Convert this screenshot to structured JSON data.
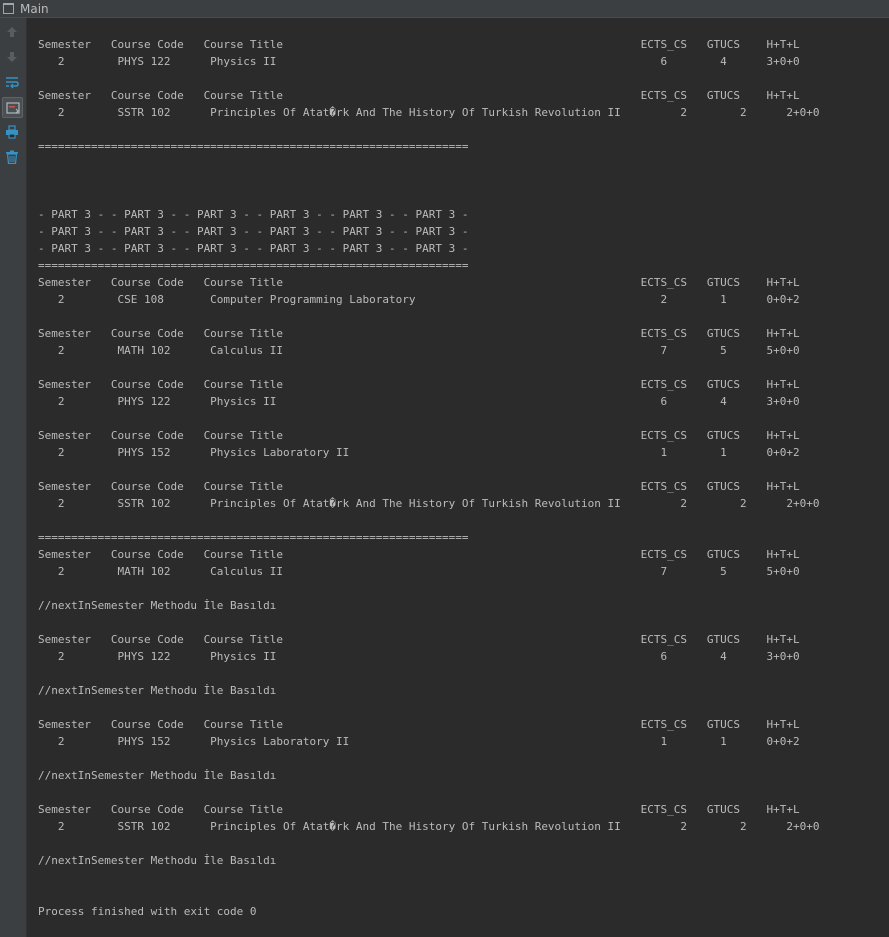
{
  "window": {
    "title": "Main"
  },
  "toolbar": {
    "icons": [
      "arrow-up-icon",
      "arrow-down-icon",
      "soft-wrap-icon",
      "scroll-to-end-icon",
      "print-icon",
      "trash-icon"
    ]
  },
  "console": {
    "lines": [
      "Semester   Course Code   Course Title                                                      ECTS_CS   GTUCS    H+T+L",
      "   2        PHYS 122      Physics II                                                          6        4      3+0+0",
      "",
      "Semester   Course Code   Course Title                                                      ECTS_CS   GTUCS    H+T+L",
      "   2        SSTR 102      Principles Of Atat�rk And The History Of Turkish Revolution II         2        2      2+0+0",
      "",
      "=================================================================",
      "",
      "",
      "",
      "- PART 3 - - PART 3 - - PART 3 - - PART 3 - - PART 3 - - PART 3 -",
      "- PART 3 - - PART 3 - - PART 3 - - PART 3 - - PART 3 - - PART 3 -",
      "- PART 3 - - PART 3 - - PART 3 - - PART 3 - - PART 3 - - PART 3 -",
      "=================================================================",
      "Semester   Course Code   Course Title                                                      ECTS_CS   GTUCS    H+T+L",
      "   2        CSE 108       Computer Programming Laboratory                                     2        1      0+0+2",
      "",
      "Semester   Course Code   Course Title                                                      ECTS_CS   GTUCS    H+T+L",
      "   2        MATH 102      Calculus II                                                         7        5      5+0+0",
      "",
      "Semester   Course Code   Course Title                                                      ECTS_CS   GTUCS    H+T+L",
      "   2        PHYS 122      Physics II                                                          6        4      3+0+0",
      "",
      "Semester   Course Code   Course Title                                                      ECTS_CS   GTUCS    H+T+L",
      "   2        PHYS 152      Physics Laboratory II                                               1        1      0+0+2",
      "",
      "Semester   Course Code   Course Title                                                      ECTS_CS   GTUCS    H+T+L",
      "   2        SSTR 102      Principles Of Atat�rk And The History Of Turkish Revolution II         2        2      2+0+0",
      "",
      "=================================================================",
      "Semester   Course Code   Course Title                                                      ECTS_CS   GTUCS    H+T+L",
      "   2        MATH 102      Calculus II                                                         7        5      5+0+0",
      "",
      "//nextInSemester Methodu İle Basıldı",
      "",
      "Semester   Course Code   Course Title                                                      ECTS_CS   GTUCS    H+T+L",
      "   2        PHYS 122      Physics II                                                          6        4      3+0+0",
      "",
      "//nextInSemester Methodu İle Basıldı",
      "",
      "Semester   Course Code   Course Title                                                      ECTS_CS   GTUCS    H+T+L",
      "   2        PHYS 152      Physics Laboratory II                                               1        1      0+0+2",
      "",
      "//nextInSemester Methodu İle Basıldı",
      "",
      "Semester   Course Code   Course Title                                                      ECTS_CS   GTUCS    H+T+L",
      "   2        SSTR 102      Principles Of Atat�rk And The History Of Turkish Revolution II         2        2      2+0+0",
      "",
      "//nextInSemester Methodu İle Basıldı",
      "",
      "",
      "Process finished with exit code 0"
    ]
  }
}
